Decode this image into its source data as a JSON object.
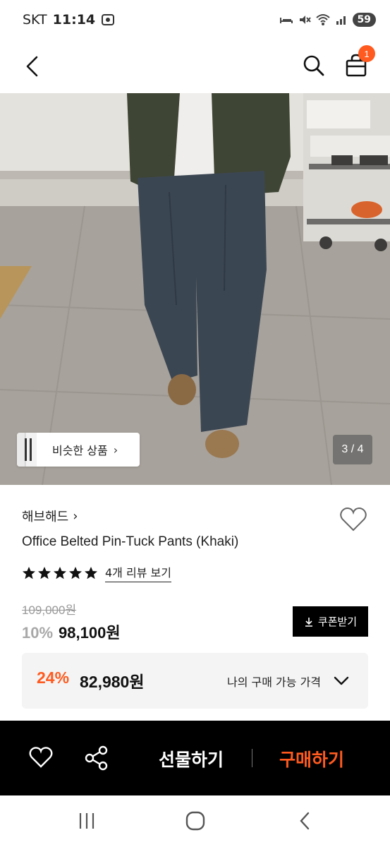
{
  "status_bar": {
    "carrier": "SKT",
    "time": "11:14",
    "battery": "59"
  },
  "header": {
    "back_icon": "back-arrow-icon",
    "search_icon": "search-icon",
    "cart_icon": "shopping-bag-icon",
    "cart_badge": "1"
  },
  "gallery": {
    "similar_label": "비슷한 상품",
    "chevron": "›",
    "counter": "3 / 4"
  },
  "product": {
    "brand": "해브해드",
    "brand_chevron": "›",
    "title": "Office Belted Pin-Tuck Pants (Khaki)",
    "rating_stars": 5,
    "review_link": "4개 리뷰 보기",
    "original_price": "109,000원",
    "discount": "10%",
    "sale_price": "98,100원",
    "coupon_button": "쿠폰받기",
    "best": {
      "discount": "24%",
      "price": "82,980원",
      "label": "나의 구매 가능 가격"
    }
  },
  "action_bar": {
    "gift_label": "선물하기",
    "buy_label": "구매하기"
  },
  "colors": {
    "accent": "#ff5a1f",
    "black": "#000000",
    "muted": "#a8a8a8"
  }
}
